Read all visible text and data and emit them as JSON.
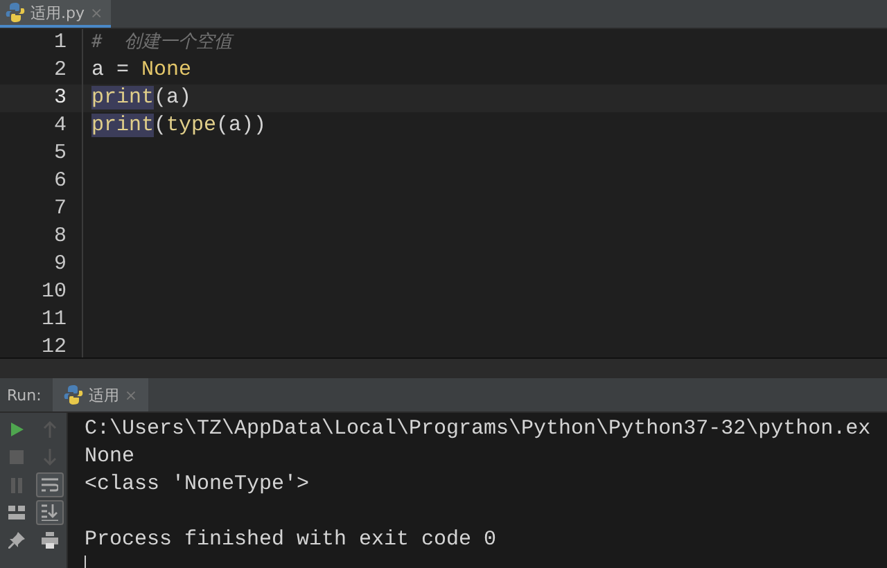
{
  "editor_tabs": [
    {
      "label": "适用.py",
      "close": "×",
      "selected": true
    }
  ],
  "editor": {
    "lines": [
      {
        "number": "1",
        "current": false,
        "tokens": [
          {
            "text": "#  创建一个空值",
            "kind": "comment",
            "highlighted": false
          }
        ]
      },
      {
        "number": "2",
        "current": false,
        "tokens": [
          {
            "text": "a = ",
            "kind": "plain",
            "highlighted": false
          },
          {
            "text": "None",
            "kind": "keyword",
            "highlighted": false
          }
        ]
      },
      {
        "number": "3",
        "current": true,
        "tokens": [
          {
            "text": "print",
            "kind": "builtin",
            "highlighted": true
          },
          {
            "text": "(a)",
            "kind": "plain",
            "highlighted": false
          }
        ]
      },
      {
        "number": "4",
        "current": false,
        "tokens": [
          {
            "text": "print",
            "kind": "builtin",
            "highlighted": true
          },
          {
            "text": "(",
            "kind": "plain",
            "highlighted": false
          },
          {
            "text": "type",
            "kind": "builtin",
            "highlighted": false
          },
          {
            "text": "(a))",
            "kind": "plain",
            "highlighted": false
          }
        ]
      },
      {
        "number": "5",
        "current": false
      },
      {
        "number": "6",
        "current": false
      },
      {
        "number": "7",
        "current": false
      },
      {
        "number": "8",
        "current": false
      },
      {
        "number": "9",
        "current": false
      },
      {
        "number": "10",
        "current": false
      },
      {
        "number": "11",
        "current": false
      },
      {
        "number": "12",
        "current": false
      }
    ]
  },
  "run_panel": {
    "label": "Run:",
    "tabs": [
      {
        "label": "适用",
        "close": "×",
        "selected": true
      }
    ],
    "toolbar_left": [
      {
        "kind": "run"
      },
      {
        "kind": "stop"
      },
      {
        "kind": "pause"
      },
      {
        "kind": "layout"
      },
      {
        "kind": "pin"
      }
    ],
    "toolbar_right": [
      {
        "kind": "up",
        "on": false
      },
      {
        "kind": "down",
        "on": false
      },
      {
        "kind": "wrap",
        "on": true
      },
      {
        "kind": "scroll",
        "on": true
      },
      {
        "kind": "print",
        "on": false
      }
    ],
    "console": {
      "command": "C:\\Users\\TZ\\AppData\\Local\\Programs\\Python\\Python37-32\\python.ex",
      "output": [
        "None",
        "<class 'NoneType'>"
      ],
      "exit_message": "Process finished with exit code 0"
    }
  }
}
